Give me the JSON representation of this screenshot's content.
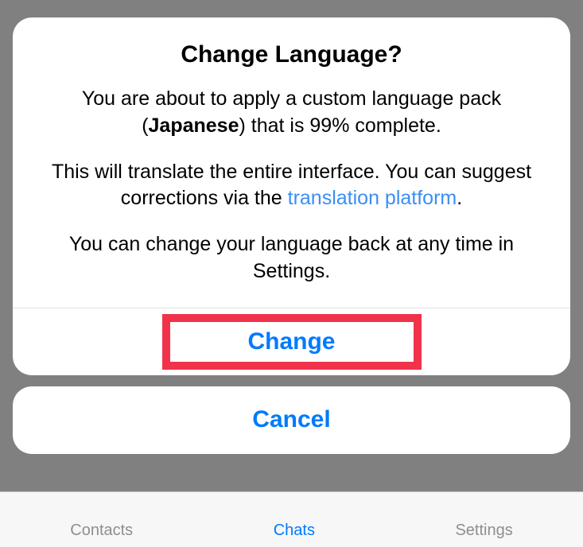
{
  "tabbar": {
    "contacts": "Contacts",
    "chats": "Chats",
    "settings": "Settings"
  },
  "alert": {
    "title": "Change Language?",
    "body_pre": "You are about to apply a custom language pack (",
    "language": "Japanese",
    "body_post_lang": ") that is ",
    "percent": "99%",
    "body_complete": " complete.",
    "para2_pre": "This will translate the entire interface. You can suggest corrections via the ",
    "link_text": "translation platform",
    "para2_post": ".",
    "para3": "You can change your language back at any time in Settings.",
    "change_label": "Change",
    "cancel_label": "Cancel"
  }
}
